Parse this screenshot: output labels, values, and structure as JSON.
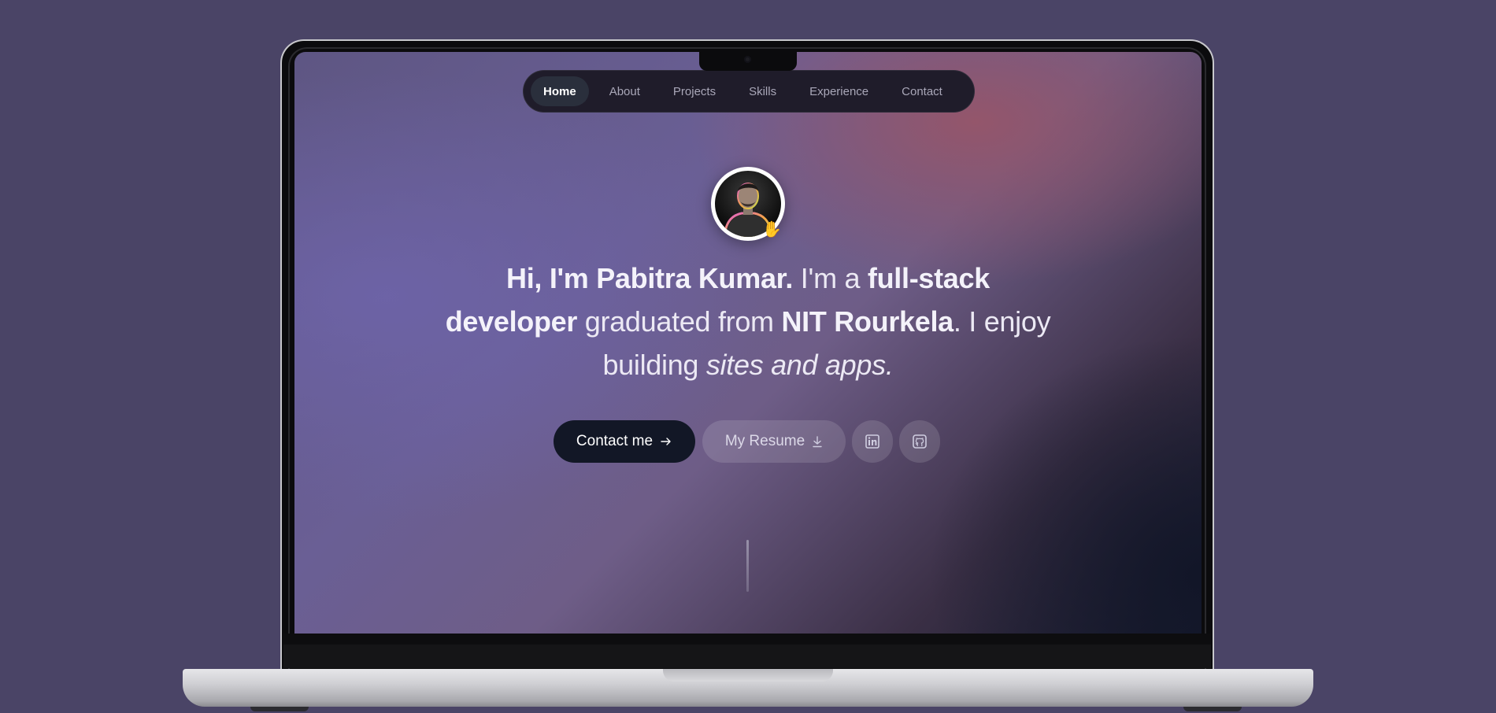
{
  "nav": {
    "items": [
      {
        "label": "Home",
        "active": true
      },
      {
        "label": "About"
      },
      {
        "label": "Projects"
      },
      {
        "label": "Skills"
      },
      {
        "label": "Experience"
      },
      {
        "label": "Contact"
      }
    ]
  },
  "hero": {
    "avatar_icon": "profile-photo",
    "wave_icon": "waving-hand",
    "headline": {
      "greeting": "Hi, I'm Pabitra Kumar.",
      "im_a": " I'm a ",
      "role": "full-stack developer",
      "graduated": " graduated from ",
      "school": "NIT Rourkela",
      "enjoy": ". I enjoy building ",
      "things": "sites and apps."
    }
  },
  "actions": {
    "contact_label": "Contact me",
    "contact_icon": "arrow-right-icon",
    "resume_label": "My Resume",
    "resume_icon": "download-icon",
    "linkedin_icon": "linkedin-icon",
    "github_icon": "github-icon"
  },
  "colors": {
    "page_bg": "#4a4466",
    "nav_bg": "#1f1c2a",
    "contact_button_bg": "#121726"
  }
}
